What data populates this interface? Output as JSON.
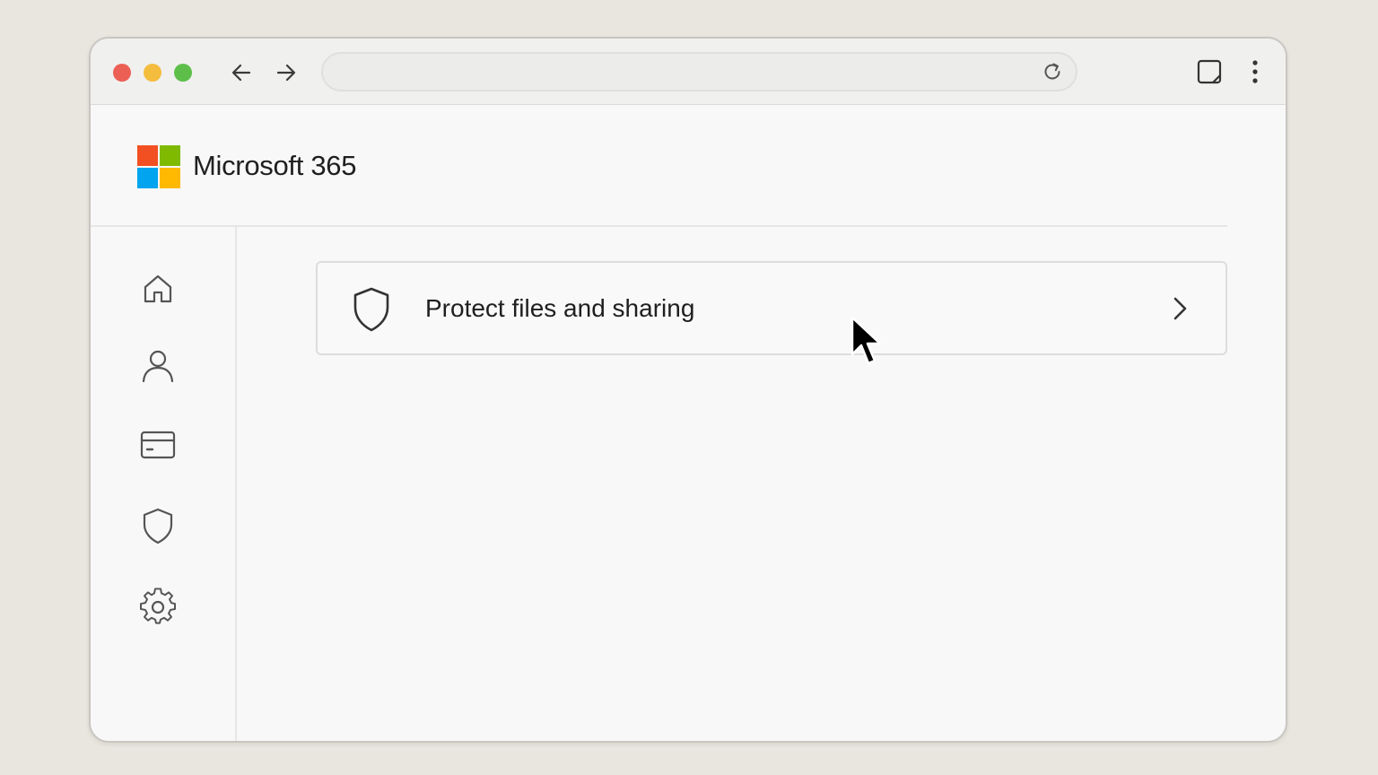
{
  "browser": {
    "address_value": "",
    "address_placeholder": ""
  },
  "app": {
    "title": "Microsoft 365",
    "logo_colors": [
      "#f25022",
      "#7fba00",
      "#00a4ef",
      "#ffb900"
    ]
  },
  "sidebar": {
    "items": [
      {
        "name": "home",
        "icon": "home-icon"
      },
      {
        "name": "users",
        "icon": "person-icon"
      },
      {
        "name": "billing",
        "icon": "card-icon"
      },
      {
        "name": "security",
        "icon": "shield-icon"
      },
      {
        "name": "settings",
        "icon": "gear-icon"
      }
    ]
  },
  "main": {
    "card": {
      "label": "Protect files and sharing",
      "icon": "shield-icon",
      "action_icon": "chevron-right-icon"
    }
  }
}
